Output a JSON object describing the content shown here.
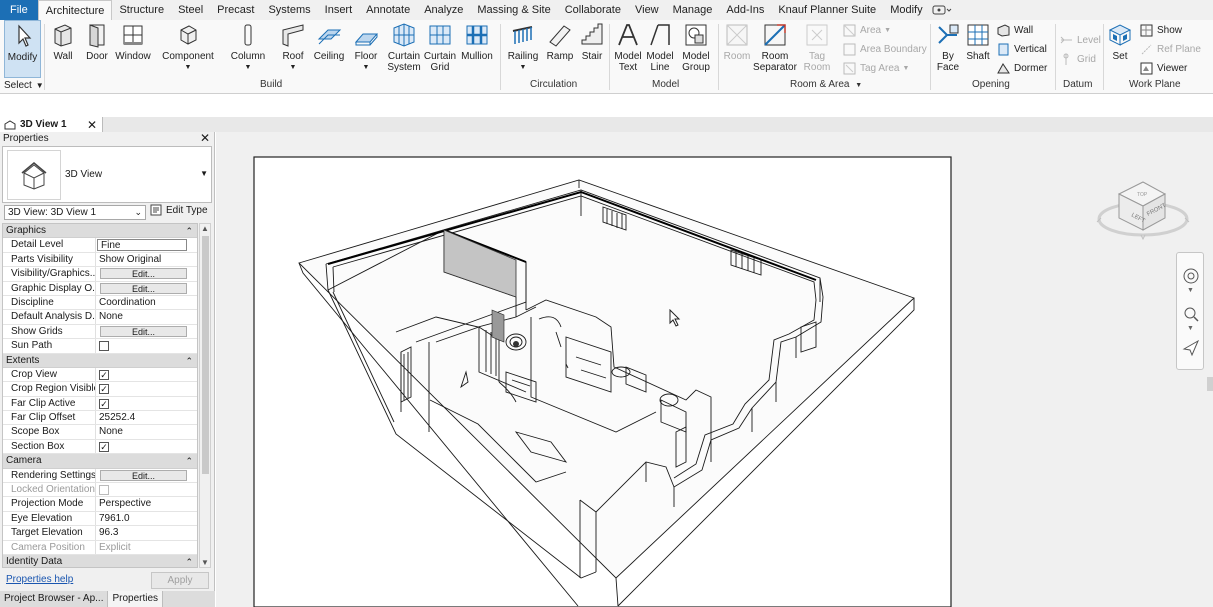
{
  "menu": {
    "tabs": [
      "File",
      "Architecture",
      "Structure",
      "Steel",
      "Precast",
      "Systems",
      "Insert",
      "Annotate",
      "Analyze",
      "Massing & Site",
      "Collaborate",
      "View",
      "Manage",
      "Add-Ins",
      "Knauf Planner Suite",
      "Modify"
    ],
    "active_tab": "Architecture"
  },
  "ribbon": {
    "select": {
      "modify": "Modify",
      "select_label": "Select"
    },
    "build": {
      "wall": "Wall",
      "door": "Door",
      "window": "Window",
      "component": "Component",
      "column": "Column",
      "roof": "Roof",
      "ceiling": "Ceiling",
      "floor": "Floor",
      "curtain_system": [
        "Curtain",
        "System"
      ],
      "curtain_grid": [
        "Curtain",
        "Grid"
      ],
      "mullion": "Mullion",
      "panel": "Build"
    },
    "circulation": {
      "railing": "Railing",
      "ramp": "Ramp",
      "stair": "Stair",
      "panel": "Circulation"
    },
    "model": {
      "model_text": [
        "Model",
        "Text"
      ],
      "model_line": [
        "Model",
        "Line"
      ],
      "model_group": [
        "Model",
        "Group"
      ],
      "panel": "Model"
    },
    "room_area": {
      "room": "Room",
      "room_separator": [
        "Room",
        "Separator"
      ],
      "tag_room": [
        "Tag",
        "Room"
      ],
      "area": "Area",
      "area_boundary": "Area  Boundary",
      "tag_area": "Tag  Area",
      "panel": "Room & Area"
    },
    "opening": {
      "by_face": [
        "By",
        "Face"
      ],
      "shaft": "Shaft",
      "wall": "Wall",
      "vertical": "Vertical",
      "dormer": "Dormer",
      "panel": "Opening"
    },
    "datum": {
      "level": "Level",
      "grid": "Grid",
      "panel": "Datum"
    },
    "work_plane": {
      "set": "Set",
      "show": "Show",
      "ref_plane": "Ref  Plane",
      "viewer": "Viewer",
      "panel": "Work Plane"
    }
  },
  "view_tab": {
    "title": "3D View 1",
    "close": "✕"
  },
  "properties": {
    "title": "Properties",
    "close": "✕",
    "type_name": "3D View",
    "view_selector": "3D View: 3D View 1",
    "edit_type": "Edit Type",
    "groups": [
      {
        "name": "Graphics",
        "rows": [
          {
            "key": "Detail Level",
            "value": "Fine",
            "kind": "box"
          },
          {
            "key": "Parts Visibility",
            "value": "Show Original",
            "kind": "text"
          },
          {
            "key": "Visibility/Graphics...",
            "value": "Edit...",
            "kind": "button"
          },
          {
            "key": "Graphic Display O...",
            "value": "Edit...",
            "kind": "button"
          },
          {
            "key": "Discipline",
            "value": "Coordination",
            "kind": "text"
          },
          {
            "key": "Default Analysis D...",
            "value": "None",
            "kind": "text"
          },
          {
            "key": "Show Grids",
            "value": "Edit...",
            "kind": "button"
          },
          {
            "key": "Sun Path",
            "value": "",
            "kind": "check",
            "checked": false
          }
        ]
      },
      {
        "name": "Extents",
        "rows": [
          {
            "key": "Crop View",
            "value": "",
            "kind": "check",
            "checked": true
          },
          {
            "key": "Crop Region Visible",
            "value": "",
            "kind": "check",
            "checked": true
          },
          {
            "key": "Far Clip Active",
            "value": "",
            "kind": "check",
            "checked": true
          },
          {
            "key": "Far Clip Offset",
            "value": "25252.4",
            "kind": "text"
          },
          {
            "key": "Scope Box",
            "value": "None",
            "kind": "text"
          },
          {
            "key": "Section Box",
            "value": "",
            "kind": "check",
            "checked": true
          }
        ]
      },
      {
        "name": "Camera",
        "rows": [
          {
            "key": "Rendering Settings",
            "value": "Edit...",
            "kind": "button"
          },
          {
            "key": "Locked Orientation",
            "value": "",
            "kind": "check",
            "checked": false,
            "dim": true
          },
          {
            "key": "Projection Mode",
            "value": "Perspective",
            "kind": "text"
          },
          {
            "key": "Eye Elevation",
            "value": "7961.0",
            "kind": "text"
          },
          {
            "key": "Target Elevation",
            "value": "96.3",
            "kind": "text"
          },
          {
            "key": "Camera Position",
            "value": "Explicit",
            "kind": "text",
            "dim": true
          }
        ]
      },
      {
        "name": "Identity Data",
        "rows": []
      }
    ],
    "help": "Properties help",
    "apply": "Apply",
    "bottom_tabs": [
      "Project Browser - Ap...",
      "Properties"
    ]
  },
  "viewcube": {
    "left": "LEFT",
    "front": "FRONT",
    "top": "TOP"
  }
}
